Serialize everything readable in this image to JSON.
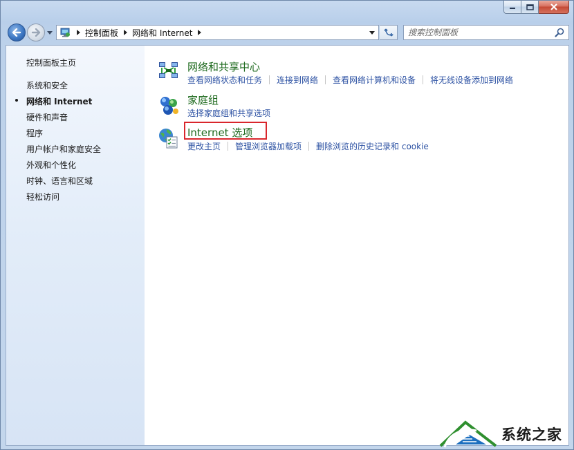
{
  "window": {
    "caption_buttons": [
      "minimize",
      "maximize",
      "close"
    ]
  },
  "toolbar": {
    "breadcrumbs": [
      "控制面板",
      "网络和 Internet"
    ],
    "search_placeholder": "搜索控制面板"
  },
  "sidebar": {
    "home": "控制面板主页",
    "items": [
      {
        "label": "系统和安全",
        "active": false
      },
      {
        "label": "网络和 Internet",
        "active": true
      },
      {
        "label": "硬件和声音",
        "active": false
      },
      {
        "label": "程序",
        "active": false
      },
      {
        "label": "用户帐户和家庭安全",
        "active": false
      },
      {
        "label": "外观和个性化",
        "active": false
      },
      {
        "label": "时钟、语言和区域",
        "active": false
      },
      {
        "label": "轻松访问",
        "active": false
      }
    ]
  },
  "categories": [
    {
      "title": "网络和共享中心",
      "icon": "network-sharing-icon",
      "links": [
        "查看网络状态和任务",
        "连接到网络",
        "查看网络计算机和设备",
        "将无线设备添加到网络"
      ]
    },
    {
      "title": "家庭组",
      "icon": "homegroup-icon",
      "links": [
        "选择家庭组和共享选项"
      ]
    },
    {
      "title": "Internet 选项",
      "icon": "internet-options-icon",
      "highlighted": true,
      "links": [
        "更改主页",
        "管理浏览器加载项",
        "删除浏览的历史记录和 cookie"
      ]
    }
  ],
  "watermark": {
    "text": "系统之家"
  },
  "colors": {
    "category_title": "#1e6a1e",
    "link": "#2d52a3",
    "highlight_box": "#d9262c",
    "sidebar_top": "#f3f7fd",
    "sidebar_bottom": "#d7e4f5"
  }
}
